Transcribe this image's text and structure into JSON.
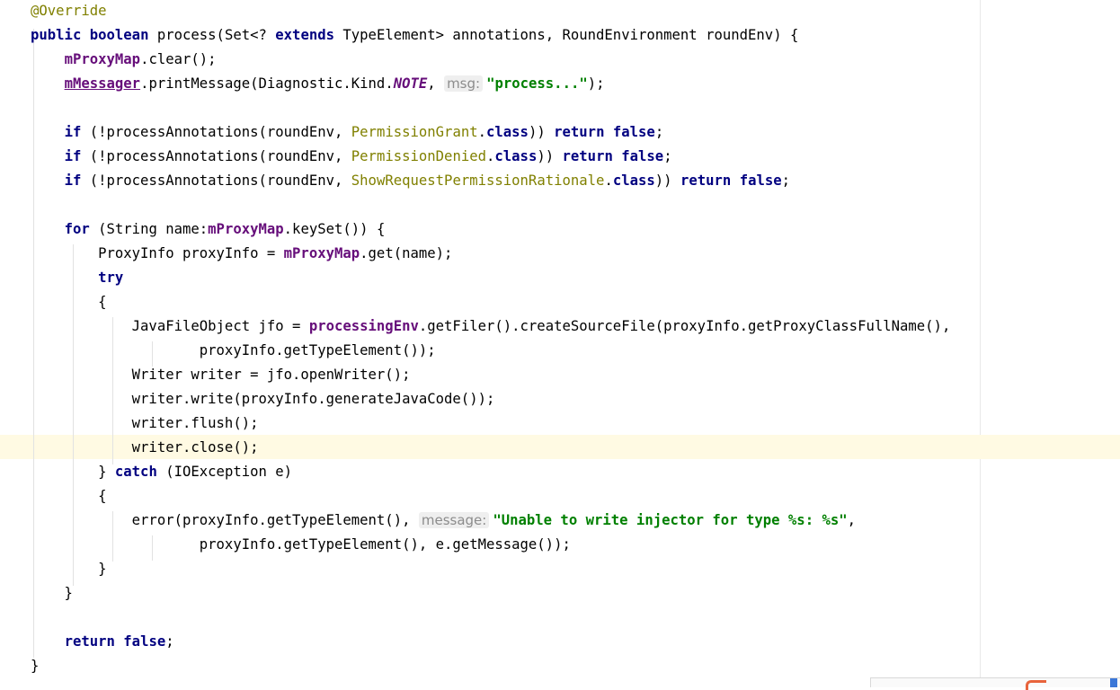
{
  "editor": {
    "lines": [
      {
        "spans": [
          {
            "c": "ann",
            "t": "@Override"
          }
        ]
      },
      {
        "spans": [
          {
            "c": "kw",
            "t": "public"
          },
          {
            "c": "",
            "t": " "
          },
          {
            "c": "kw",
            "t": "boolean"
          },
          {
            "c": "",
            "t": " process(Set<? "
          },
          {
            "c": "kw",
            "t": "extends"
          },
          {
            "c": "",
            "t": " TypeElement> annotations, RoundEnvironment roundEnv) {"
          }
        ]
      },
      {
        "spans": [
          {
            "c": "",
            "t": "    "
          },
          {
            "c": "field",
            "t": "mProxyMap"
          },
          {
            "c": "",
            "t": ".clear();"
          }
        ]
      },
      {
        "spans": [
          {
            "c": "",
            "t": "    "
          },
          {
            "c": "field-u",
            "t": "mMessager"
          },
          {
            "c": "",
            "t": ".printMessage(Diagnostic.Kind."
          },
          {
            "c": "static-it",
            "t": "NOTE"
          },
          {
            "c": "",
            "t": ", "
          },
          {
            "c": "hint",
            "t": "msg:"
          },
          {
            "c": "str",
            "t": "\"process...\""
          },
          {
            "c": "",
            "t": ");"
          }
        ]
      },
      {
        "spans": []
      },
      {
        "spans": [
          {
            "c": "",
            "t": "    "
          },
          {
            "c": "kw",
            "t": "if"
          },
          {
            "c": "",
            "t": " (!processAnnotations(roundEnv, "
          },
          {
            "c": "cls",
            "t": "PermissionGrant"
          },
          {
            "c": "",
            "t": "."
          },
          {
            "c": "kw",
            "t": "class"
          },
          {
            "c": "",
            "t": ")) "
          },
          {
            "c": "kw",
            "t": "return"
          },
          {
            "c": "",
            "t": " "
          },
          {
            "c": "kw",
            "t": "false"
          },
          {
            "c": "",
            "t": ";"
          }
        ]
      },
      {
        "spans": [
          {
            "c": "",
            "t": "    "
          },
          {
            "c": "kw",
            "t": "if"
          },
          {
            "c": "",
            "t": " (!processAnnotations(roundEnv, "
          },
          {
            "c": "cls",
            "t": "PermissionDenied"
          },
          {
            "c": "",
            "t": "."
          },
          {
            "c": "kw",
            "t": "class"
          },
          {
            "c": "",
            "t": ")) "
          },
          {
            "c": "kw",
            "t": "return"
          },
          {
            "c": "",
            "t": " "
          },
          {
            "c": "kw",
            "t": "false"
          },
          {
            "c": "",
            "t": ";"
          }
        ]
      },
      {
        "spans": [
          {
            "c": "",
            "t": "    "
          },
          {
            "c": "kw",
            "t": "if"
          },
          {
            "c": "",
            "t": " (!processAnnotations(roundEnv, "
          },
          {
            "c": "cls",
            "t": "ShowRequestPermissionRationale"
          },
          {
            "c": "",
            "t": "."
          },
          {
            "c": "kw",
            "t": "class"
          },
          {
            "c": "",
            "t": ")) "
          },
          {
            "c": "kw",
            "t": "return"
          },
          {
            "c": "",
            "t": " "
          },
          {
            "c": "kw",
            "t": "false"
          },
          {
            "c": "",
            "t": ";"
          }
        ]
      },
      {
        "spans": []
      },
      {
        "spans": [
          {
            "c": "",
            "t": "    "
          },
          {
            "c": "kw",
            "t": "for"
          },
          {
            "c": "",
            "t": " (String name:"
          },
          {
            "c": "field",
            "t": "mProxyMap"
          },
          {
            "c": "",
            "t": ".keySet()) {"
          }
        ]
      },
      {
        "spans": [
          {
            "c": "",
            "t": "        ProxyInfo proxyInfo = "
          },
          {
            "c": "field",
            "t": "mProxyMap"
          },
          {
            "c": "",
            "t": ".get(name);"
          }
        ]
      },
      {
        "spans": [
          {
            "c": "",
            "t": "        "
          },
          {
            "c": "kw",
            "t": "try"
          }
        ]
      },
      {
        "spans": [
          {
            "c": "",
            "t": "        {"
          }
        ]
      },
      {
        "spans": [
          {
            "c": "",
            "t": "            JavaFileObject jfo = "
          },
          {
            "c": "field",
            "t": "processingEnv"
          },
          {
            "c": "",
            "t": ".getFiler().createSourceFile(proxyInfo.getProxyClassFullName(),"
          }
        ]
      },
      {
        "spans": [
          {
            "c": "",
            "t": "                    proxyInfo.getTypeElement());"
          }
        ]
      },
      {
        "spans": [
          {
            "c": "",
            "t": "            Writer writer = jfo.openWriter();"
          }
        ]
      },
      {
        "spans": [
          {
            "c": "",
            "t": "            writer.write(proxyInfo.generateJavaCode());"
          }
        ]
      },
      {
        "spans": [
          {
            "c": "",
            "t": "            writer.flush();"
          }
        ]
      },
      {
        "spans": [
          {
            "c": "",
            "t": "            writer.close();"
          }
        ]
      },
      {
        "spans": [
          {
            "c": "",
            "t": "        } "
          },
          {
            "c": "kw",
            "t": "catch"
          },
          {
            "c": "",
            "t": " (IOException e)"
          }
        ]
      },
      {
        "spans": [
          {
            "c": "",
            "t": "        {"
          }
        ]
      },
      {
        "spans": [
          {
            "c": "",
            "t": "            error(proxyInfo.getTypeElement(), "
          },
          {
            "c": "hint",
            "t": "message:"
          },
          {
            "c": "str",
            "t": "\"Unable to write injector for type %s: %s\""
          },
          {
            "c": "",
            "t": ","
          }
        ]
      },
      {
        "spans": [
          {
            "c": "",
            "t": "                    proxyInfo.getTypeElement(), e.getMessage());"
          }
        ]
      },
      {
        "spans": [
          {
            "c": "",
            "t": "        }"
          }
        ]
      },
      {
        "spans": [
          {
            "c": "",
            "t": "    }"
          }
        ]
      },
      {
        "spans": []
      },
      {
        "spans": [
          {
            "c": "",
            "t": "    "
          },
          {
            "c": "kw",
            "t": "return"
          },
          {
            "c": "",
            "t": " "
          },
          {
            "c": "kw",
            "t": "false"
          },
          {
            "c": "",
            "t": ";"
          }
        ]
      },
      {
        "spans": [
          {
            "c": "",
            "t": "}"
          }
        ]
      }
    ]
  },
  "colors": {
    "keyword": "#000080",
    "annotation": "#808000",
    "field": "#660e7a",
    "string": "#008000",
    "current_line": "#fffae3"
  }
}
